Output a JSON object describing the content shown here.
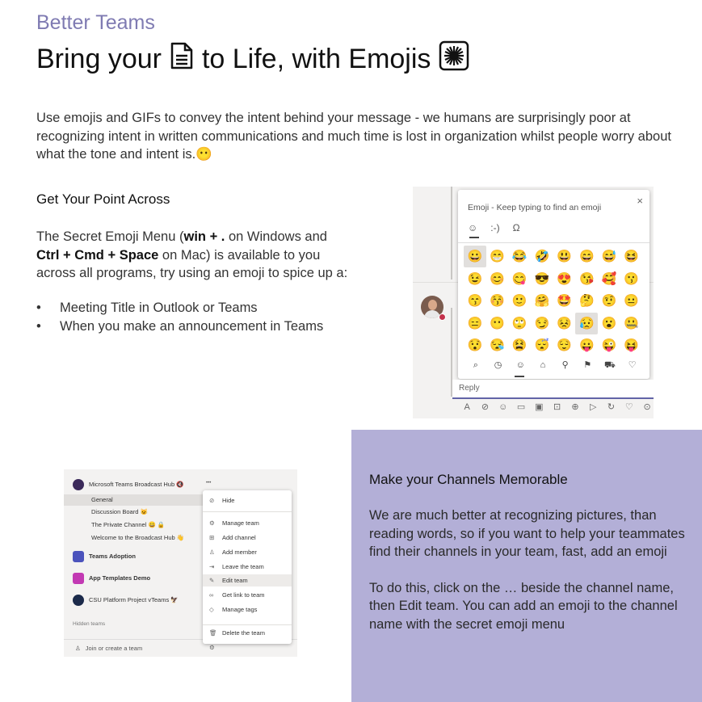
{
  "header": {
    "subtitle": "Better Teams",
    "title_part1": "Bring your",
    "title_part2": "to Life, with Emojis"
  },
  "intro": "Use emojis and GIFs to convey the intent behind your message - we humans are surprisingly poor at recognizing intent in written communications and much time is lost in organization whilst people worry about what the tone and intent is.",
  "intro_emoji": "😶",
  "point": {
    "heading": "Get Your Point Across",
    "text_a": "The Secret Emoji Menu (",
    "key_win": "win + .",
    "text_b": " on Windows and ",
    "key_mac": "Ctrl + Cmd + Space",
    "text_c": " on Mac) is available to you across all programs, try using an emoji to spice up a:",
    "bullets": [
      "Meeting Title in Outlook or Teams",
      "When you make an announcement in Teams"
    ]
  },
  "emoji_panel": {
    "header": "Emoji - Keep typing to find an emoji",
    "close": "×",
    "tabs": [
      "☺",
      ":-)",
      "Ω"
    ],
    "rows": [
      [
        "😀",
        "😁",
        "😂",
        "🤣",
        "😃",
        "😄",
        "😅",
        "😆"
      ],
      [
        "😉",
        "😊",
        "😋",
        "😎",
        "😍",
        "😘",
        "🥰",
        "😗"
      ],
      [
        "😙",
        "😚",
        "🙂",
        "🤗",
        "🤩",
        "🤔",
        "🤨",
        "😐"
      ],
      [
        "😑",
        "😶",
        "🙄",
        "😏",
        "😣",
        "😥",
        "😮",
        "🤐"
      ],
      [
        "😯",
        "😪",
        "😫",
        "😴",
        "😌",
        "😛",
        "😜",
        "😝"
      ]
    ],
    "categories": [
      "⌕",
      "◷",
      "☺",
      "⌂",
      "⚲",
      "⚑",
      "⛟",
      "♡"
    ],
    "reply": "Reply",
    "toolbar": [
      "A",
      "⊘",
      "☺",
      "▭",
      "▣",
      "⊡",
      "⊕",
      "▷",
      "↻",
      "♡",
      "⊙"
    ]
  },
  "teams_shot": {
    "team1": "Microsoft Teams Broadcast Hub 🔇",
    "channels": [
      "General",
      "Discussion Board 😺",
      "The Private Channel 😀 🔒",
      "Welcome to the Broadcast Hub 👋"
    ],
    "team2": "Teams Adoption",
    "team3": "App Templates Demo",
    "team4": "CSU Platform Project vTeams 🦅",
    "hidden": "Hidden teams",
    "join": "Join or create a team",
    "dots": "•••",
    "menu": [
      "Hide",
      "Manage team",
      "Add channel",
      "Add member",
      "Leave the team",
      "Edit team",
      "Get link to team",
      "Manage tags",
      "Delete the team"
    ],
    "menu_glyphs": [
      "⊘",
      "⚙",
      "⊞",
      "♙",
      "⇥",
      "✎",
      "∞",
      "◇",
      "🗑"
    ]
  },
  "channels": {
    "heading": "Make your Channels Memorable",
    "para1": "We are much better at recognizing pictures, than reading words, so if you want to help your teammates find their channels in your team, fast, add an emoji",
    "para2": "To do this, click on the … beside the channel name, then Edit team. You can add an emoji to the channel name with the secret emoji menu"
  },
  "colors": {
    "accent": "#7f7bb2",
    "panel_bg": "#b3afd7",
    "teams_purple": "#6264a7"
  },
  "icons": {
    "title_icon_1": "page-facing-up-icon",
    "title_icon_2": "sparkle-burst-icon"
  }
}
